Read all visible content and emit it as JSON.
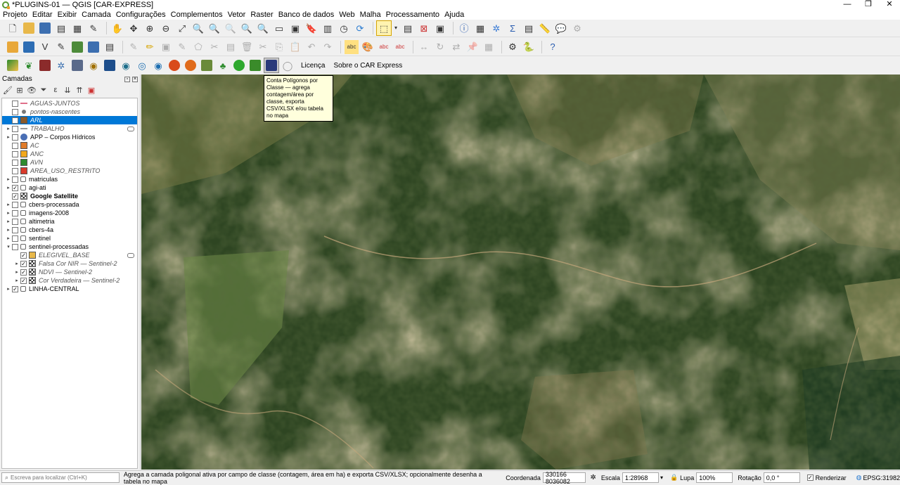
{
  "window": {
    "title": "*PLUGINS-01 — QGIS [CAR-EXPRESS]",
    "controls": [
      "—",
      "❐",
      "✕"
    ]
  },
  "menu": [
    "Projeto",
    "Editar",
    "Exibir",
    "Camada",
    "Configurações",
    "Complementos",
    "Vetor",
    "Raster",
    "Banco de dados",
    "Web",
    "Malha",
    "Processamento",
    "Ajuda"
  ],
  "plugin_toolbar": {
    "license": "Licença",
    "about": "Sobre o CAR Express"
  },
  "tooltip": {
    "text": "Conta Polígonos por Classe — agrega contagem/área por classe, exporta CSV/XLSX e/ou tabela no mapa"
  },
  "layers_panel": {
    "title": "Camadas",
    "layers": [
      {
        "name": "AGUAS-JUNTOS",
        "checked": false,
        "symbol": "line",
        "color": "#e0708a",
        "style": "italic",
        "expand": ""
      },
      {
        "name": "pontos-nascentes",
        "checked": false,
        "symbol": "point",
        "color": "#7a7a7a",
        "style": "italic",
        "expand": ""
      },
      {
        "name": "ARL",
        "checked": false,
        "symbol": "fill",
        "color": "#8b5a2b",
        "style": "italic",
        "expand": "",
        "selected": true
      },
      {
        "name": "TRABALHO",
        "checked": false,
        "symbol": "line",
        "color": "#999999",
        "style": "italic",
        "expand": "▸",
        "badge": true
      },
      {
        "name": "APP – Corpos Hídricos",
        "checked": false,
        "symbol": "wms",
        "color": "#4a6fb5",
        "style": "normal",
        "expand": "▸"
      },
      {
        "name": "AC",
        "checked": false,
        "symbol": "fill",
        "color": "#e07b2a",
        "style": "italic",
        "expand": ""
      },
      {
        "name": "ANC",
        "checked": false,
        "symbol": "fill",
        "color": "#f2a81d",
        "style": "italic",
        "expand": ""
      },
      {
        "name": "AVN",
        "checked": false,
        "symbol": "fill",
        "color": "#2e8b2e",
        "style": "italic",
        "expand": ""
      },
      {
        "name": "AREA_USO_RESTRITO",
        "checked": false,
        "symbol": "fill",
        "color": "#d93a2b",
        "style": "italic",
        "expand": ""
      },
      {
        "name": "matriculas",
        "checked": false,
        "symbol": "group",
        "color": "#666666",
        "style": "normal",
        "expand": "▸"
      },
      {
        "name": "agi-ati",
        "checked": true,
        "symbol": "group",
        "color": "#666666",
        "style": "normal",
        "expand": "▸"
      },
      {
        "name": "Google Satellite",
        "checked": true,
        "symbol": "raster",
        "color": "#333333",
        "style": "bold",
        "expand": ""
      },
      {
        "name": "cbers-processada",
        "checked": false,
        "symbol": "group",
        "color": "#666666",
        "style": "normal",
        "expand": "▸"
      },
      {
        "name": "imagens-2008",
        "checked": false,
        "symbol": "group",
        "color": "#666666",
        "style": "normal",
        "expand": "▸"
      },
      {
        "name": "altimetria",
        "checked": false,
        "symbol": "group",
        "color": "#666666",
        "style": "normal",
        "expand": "▸"
      },
      {
        "name": "cbers-4a",
        "checked": false,
        "symbol": "group",
        "color": "#666666",
        "style": "normal",
        "expand": "▸"
      },
      {
        "name": "sentinel",
        "checked": false,
        "symbol": "group",
        "color": "#666666",
        "style": "normal",
        "expand": "▸"
      },
      {
        "name": "sentinel-processadas",
        "checked": false,
        "symbol": "group",
        "color": "#666666",
        "style": "normal",
        "expand": "▾"
      },
      {
        "name": "ELEGIVEL_BASE",
        "checked": true,
        "symbol": "fill",
        "color": "#e8b84a",
        "style": "italic",
        "expand": "",
        "indent": 1,
        "badge": true
      },
      {
        "name": "Falsa Cor NIR — Sentinel-2",
        "checked": true,
        "symbol": "raster",
        "color": "#333333",
        "style": "italic",
        "expand": "▸",
        "indent": 1
      },
      {
        "name": "NDVI — Sentinel-2",
        "checked": true,
        "symbol": "raster",
        "color": "#333333",
        "style": "italic",
        "expand": "▸",
        "indent": 1
      },
      {
        "name": "Cor Verdadeira — Sentinel-2",
        "checked": true,
        "symbol": "raster",
        "color": "#333333",
        "style": "italic",
        "expand": "▸",
        "indent": 1
      },
      {
        "name": "LINHA-CENTRAL",
        "checked": true,
        "symbol": "group",
        "color": "#666666",
        "style": "normal",
        "expand": "▸"
      }
    ]
  },
  "statusbar": {
    "locator_placeholder": "Escreva para localizar (Ctrl+K)",
    "message": "Agrega a camada poligonal ativa por campo de classe (contagem, área em ha) e exporta CSV/XLSX; opcionalmente desenha a tabela no mapa",
    "coord_label": "Coordenada",
    "coord_value": "330166  8036082",
    "scale_label": "Escala",
    "scale_value": "1:28968",
    "magnifier_label": "Lupa",
    "magnifier_value": "100%",
    "rotation_label": "Rotação",
    "rotation_value": "0,0 °",
    "render_label": "Renderizar",
    "crs": "EPSG:31982"
  }
}
